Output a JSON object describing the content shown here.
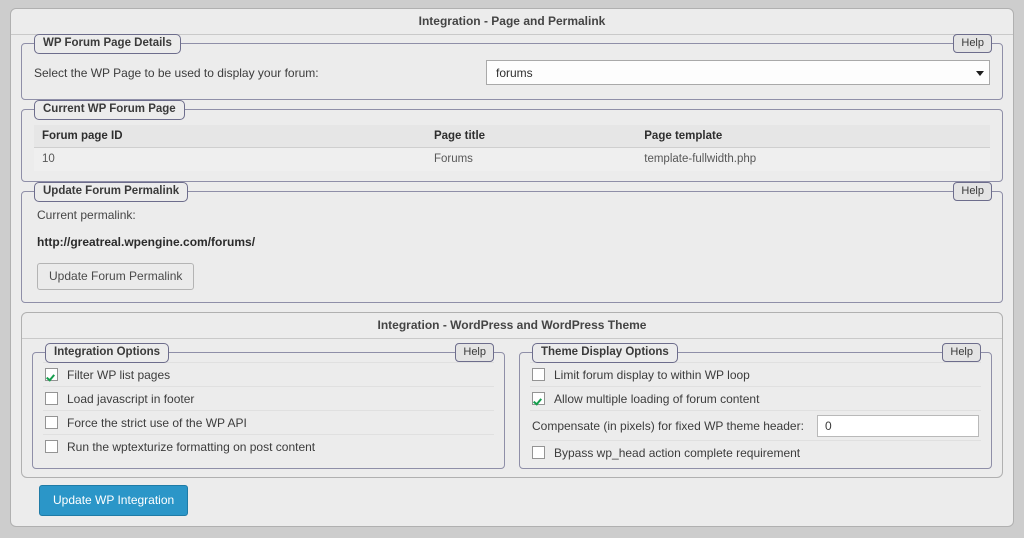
{
  "main_panel": {
    "title": "Integration - Page and Permalink",
    "page_details": {
      "legend": "WP Forum Page Details",
      "help_label": "Help",
      "select_label": "Select the WP Page to be used to display your forum:",
      "select_value": "forums",
      "select_icon": "chevron-down-icon"
    },
    "current_page": {
      "legend": "Current WP Forum Page",
      "columns": [
        "Forum page ID",
        "Page title",
        "Page template"
      ],
      "rows": [
        [
          "10",
          "Forums",
          "template-fullwidth.php"
        ]
      ]
    },
    "permalink": {
      "legend": "Update Forum Permalink",
      "help_label": "Help",
      "current_label": "Current permalink:",
      "url": "http://greatreal.wpengine.com/forums/",
      "button_label": "Update Forum Permalink"
    }
  },
  "theme_panel": {
    "title": "Integration - WordPress and WordPress Theme",
    "integration_options": {
      "legend": "Integration Options",
      "help_label": "Help",
      "items": [
        {
          "label": "Filter WP list pages",
          "checked": true
        },
        {
          "label": "Load javascript in footer",
          "checked": false
        },
        {
          "label": "Force the strict use of the WP API",
          "checked": false
        },
        {
          "label": "Run the wptexturize formatting on post content",
          "checked": false
        }
      ]
    },
    "theme_display_options": {
      "legend": "Theme Display Options",
      "help_label": "Help",
      "items": [
        {
          "label": "Limit forum display to within WP loop",
          "checked": false
        },
        {
          "label": "Allow multiple loading of forum content",
          "checked": true
        }
      ],
      "compensate_label": "Compensate (in pixels) for fixed WP theme header:",
      "compensate_value": "0",
      "bypass": {
        "label": "Bypass wp_head action complete requirement",
        "checked": false
      }
    }
  },
  "submit": {
    "label": "Update WP Integration",
    "color": "#2b96c8"
  }
}
